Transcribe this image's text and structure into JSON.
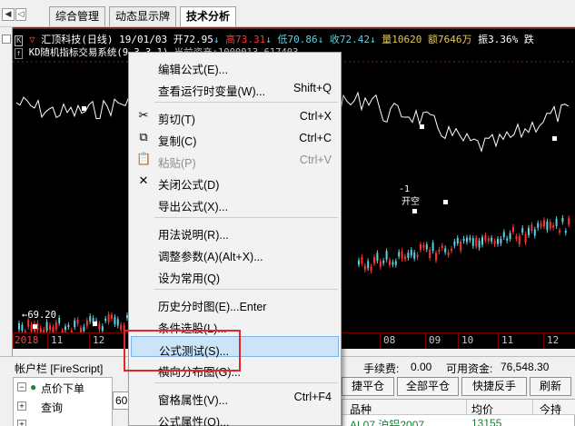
{
  "tabs": [
    {
      "label": "综合管理"
    },
    {
      "label": "动态显示牌"
    },
    {
      "label": "技术分析"
    }
  ],
  "chart": {
    "header": {
      "name": "汇顶科技(日线)",
      "date": "19/01/03",
      "open": "开72.95",
      "high": "高73.31",
      "low": "低70.86",
      "close": "收72.42",
      "volume": "量10620",
      "amount": "额7646万",
      "amplitude": "振3.36%",
      "extra": "跌"
    },
    "indicator_line": "KD随机指标交易系统(9,3,3,1)",
    "indicator_extra": "当前资产:1000013.617403",
    "signal_label": "-1",
    "signal_text": "开空",
    "low_marker": "←69.20",
    "dates": [
      "2018",
      "11",
      "12",
      "08",
      "09",
      "10",
      "11",
      "12"
    ],
    "colors": {
      "up": "#ff3232",
      "down": "#5fd0e0",
      "line": "#ffffff",
      "accent": "#ff0000"
    }
  },
  "lower": {
    "account_bar": "帐户栏 [FireScript]",
    "tree": [
      {
        "label": "点价下单"
      },
      {
        "label": "查询"
      },
      {
        "label": ""
      }
    ],
    "input_value": "603",
    "fee_label": "手续费:",
    "fee_value": "0.00",
    "available_label": "可用资金:",
    "available_value": "76,548.30",
    "buttons": [
      "捷平仓",
      "全部平仓",
      "快捷反手",
      "刷新"
    ],
    "table_headers": [
      "品种",
      "均价",
      "今持"
    ],
    "table_row": {
      "product": "AL07 沪铝2007",
      "price": "13155",
      "hold": ""
    }
  },
  "menu": {
    "items": [
      {
        "label": "编辑公式(E)...",
        "shortcut": "",
        "icon": "",
        "disabled": false
      },
      {
        "label": "查看运行时变量(W)...",
        "shortcut": "Shift+Q",
        "icon": "",
        "disabled": false
      },
      {
        "sep": true
      },
      {
        "label": "剪切(T)",
        "shortcut": "Ctrl+X",
        "icon": "scissors-icon",
        "disabled": false
      },
      {
        "label": "复制(C)",
        "shortcut": "Ctrl+C",
        "icon": "copy-icon",
        "disabled": false
      },
      {
        "label": "粘贴(P)",
        "shortcut": "Ctrl+V",
        "icon": "paste-icon",
        "disabled": true
      },
      {
        "label": "关闭公式(D)",
        "shortcut": "",
        "icon": "close-icon",
        "disabled": false
      },
      {
        "label": "导出公式(X)...",
        "shortcut": "",
        "icon": "",
        "disabled": false
      },
      {
        "sep": true
      },
      {
        "label": "用法说明(R)...",
        "shortcut": "",
        "icon": "",
        "disabled": false
      },
      {
        "label": "调整参数(A)(Alt+X)...",
        "shortcut": "",
        "icon": "",
        "disabled": false
      },
      {
        "label": "设为常用(Q)",
        "shortcut": "",
        "icon": "",
        "disabled": false
      },
      {
        "sep": true
      },
      {
        "label": "历史分时图(E)...Enter",
        "shortcut": "",
        "icon": "",
        "disabled": false
      },
      {
        "label": "条件选股(L)...",
        "shortcut": "",
        "icon": "",
        "disabled": false
      },
      {
        "label": "公式测试(S)...",
        "shortcut": "",
        "icon": "",
        "disabled": false,
        "highlighted": true
      },
      {
        "label": "横向分布图(G)...",
        "shortcut": "",
        "icon": "",
        "disabled": false
      },
      {
        "sep": true
      },
      {
        "label": "窗格属性(V)...",
        "shortcut": "Ctrl+F4",
        "icon": "",
        "disabled": false
      },
      {
        "label": "公式属性(O)...",
        "shortcut": "",
        "icon": "",
        "disabled": false
      }
    ]
  }
}
